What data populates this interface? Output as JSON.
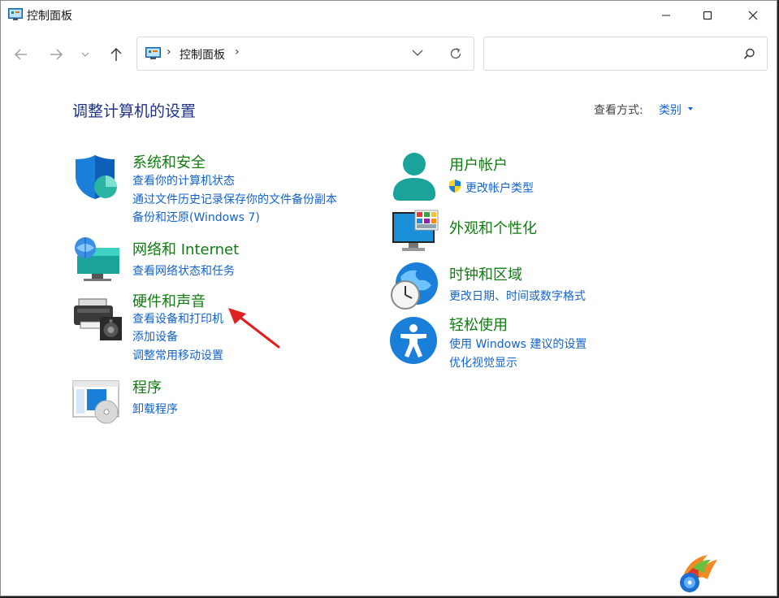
{
  "window": {
    "title": "控制面板"
  },
  "address": {
    "location": "控制面板",
    "separator": "›"
  },
  "search": {
    "placeholder": ""
  },
  "heading": "调整计算机的设置",
  "view": {
    "label": "查看方式:",
    "value": "类别"
  },
  "categories_left": [
    {
      "title": "系统和安全",
      "icon": "shield-icon",
      "links": [
        "查看你的计算机状态",
        "通过文件历史记录保存你的文件备份副本",
        "备份和还原(Windows 7)"
      ]
    },
    {
      "title": "网络和 Internet",
      "icon": "network-globe-icon",
      "links": [
        "查看网络状态和任务"
      ]
    },
    {
      "title": "硬件和声音",
      "icon": "printer-speaker-icon",
      "links": [
        "查看设备和打印机",
        "添加设备",
        "调整常用移动设置"
      ]
    },
    {
      "title": "程序",
      "icon": "programs-disc-icon",
      "links": [
        "卸载程序"
      ]
    }
  ],
  "categories_right": [
    {
      "title": "用户帐户",
      "icon": "user-accounts-icon",
      "links": [
        "更改帐户类型"
      ]
    },
    {
      "title": "外观和个性化",
      "icon": "monitor-tiles-icon",
      "links": []
    },
    {
      "title": "时钟和区域",
      "icon": "globe-clock-icon",
      "links": [
        "更改日期、时间或数字格式"
      ]
    },
    {
      "title": "轻松使用",
      "icon": "accessibility-icon",
      "links": [
        "使用 Windows 建议的设置",
        "优化视觉显示"
      ]
    }
  ],
  "colors": {
    "title_green": "#107c10",
    "link_blue": "#1464c8",
    "heading_navy": "#1e3287",
    "arrow_red": "#e02020"
  }
}
